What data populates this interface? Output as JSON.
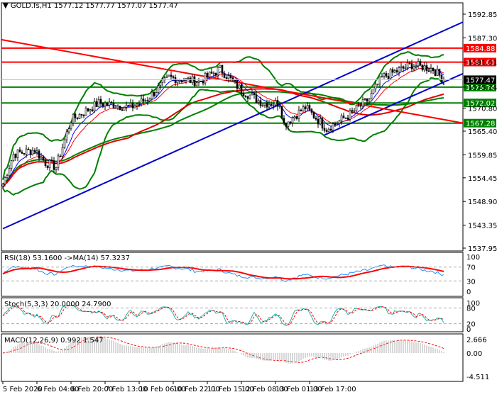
{
  "header": {
    "symbol": "GOLD.fs,H1",
    "ohlc": "1577.12 1577.77 1577.07 1577.47"
  },
  "price_axis": [
    "1592.85",
    "1587.30",
    "1581.61",
    "1575.74",
    "1570.80",
    "1565.40",
    "1559.85",
    "1554.45",
    "1548.90",
    "1543.35",
    "1537.95"
  ],
  "levels": [
    {
      "label": "1584.88",
      "price": 1584.88,
      "color": "#ff0000"
    },
    {
      "label": "1581.61",
      "price": 1581.61,
      "color": "#ff0000"
    },
    {
      "label": "1575.74",
      "price": 1575.74,
      "color": "#008000"
    },
    {
      "label": "1572.02",
      "price": 1572.02,
      "color": "#008000"
    },
    {
      "label": "1567.28",
      "price": 1567.28,
      "color": "#008000"
    }
  ],
  "current_price": "1577.47",
  "time_axis": [
    "5 Feb 2020",
    "6 Feb 04:00",
    "6 Feb 20:00",
    "7 Feb 13:00",
    "10 Feb 06:00",
    "10 Feb 22:00",
    "11 Feb 15:00",
    "12 Feb 08:00",
    "13 Feb 01:00",
    "13 Feb 17:00"
  ],
  "rsi": {
    "label": "RSI(18) 53.1600  ->MA(14) 57.3237",
    "axis": [
      "100",
      "70",
      "30",
      "0"
    ]
  },
  "stoch": {
    "label": "Stoch(5,3,3) 20.0000 24.7900",
    "axis": [
      "100",
      "80",
      "20",
      "0"
    ]
  },
  "macd": {
    "label": "MACD(12,26,9) 0.992 1.547",
    "axis": [
      "2.666",
      "0.00",
      "-4.511"
    ]
  },
  "chart_data": {
    "type": "candlestick",
    "price_range": [
      1537.95,
      1592.85
    ],
    "close_path": [
      [
        0,
        1553
      ],
      [
        5,
        1560
      ],
      [
        15,
        1561
      ],
      [
        20,
        1558
      ],
      [
        25,
        1557
      ],
      [
        32,
        1568
      ],
      [
        45,
        1572
      ],
      [
        60,
        1571
      ],
      [
        68,
        1573
      ],
      [
        78,
        1578
      ],
      [
        92,
        1577
      ],
      [
        102,
        1580
      ],
      [
        112,
        1575
      ],
      [
        122,
        1572
      ],
      [
        130,
        1572
      ],
      [
        132,
        1567
      ],
      [
        142,
        1571
      ],
      [
        152,
        1566
      ],
      [
        162,
        1569
      ],
      [
        172,
        1573
      ],
      [
        178,
        1578
      ],
      [
        192,
        1581
      ],
      [
        202,
        1580
      ],
      [
        207,
        1577.47
      ]
    ],
    "trendlines": [
      {
        "color": "#0000cc",
        "from": [
          0,
          1542.5
        ],
        "to": [
          216,
          1591
        ]
      },
      {
        "color": "#0000cc",
        "from": [
          151,
          1564.5
        ],
        "to": [
          216,
          1578.9
        ]
      },
      {
        "color": "#ff0000",
        "from": [
          -1,
          1586.9
        ],
        "to": [
          216,
          1567.3
        ]
      }
    ]
  }
}
